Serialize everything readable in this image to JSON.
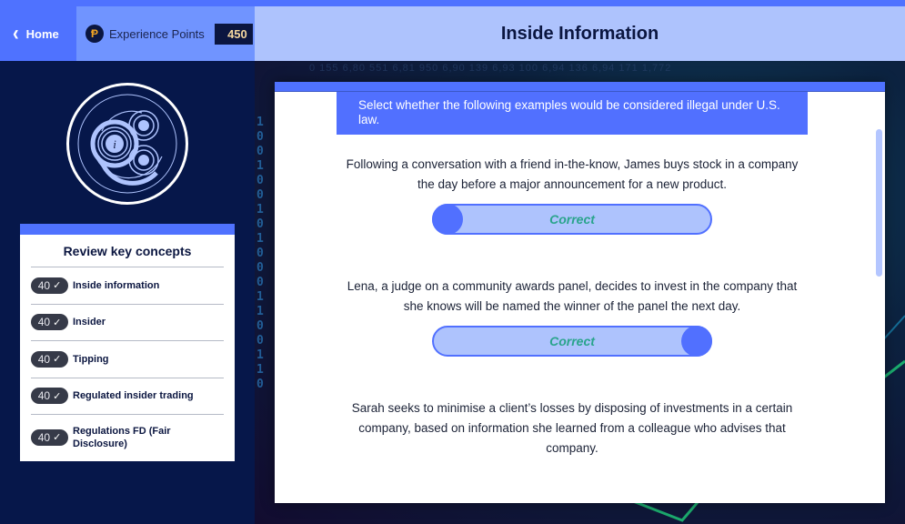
{
  "header": {
    "home_label": "Home",
    "home_icon": "chevron-left-icon",
    "xp_icon": "points-coin-icon",
    "xp_icon_glyph": "Ᵽ",
    "xp_label": "Experience Points",
    "xp_value": "450",
    "title": "Inside Information"
  },
  "sidebar": {
    "logo_icon": "inside-information-ripple-icon",
    "logo_glyph": "i",
    "review_title": "Review key concepts",
    "concepts": [
      {
        "points": "40",
        "check": "✓",
        "label": "Inside information"
      },
      {
        "points": "40",
        "check": "✓",
        "label": "Insider"
      },
      {
        "points": "40",
        "check": "✓",
        "label": "Tipping"
      },
      {
        "points": "40",
        "check": "✓",
        "label": "Regulated insider trading"
      },
      {
        "points": "40",
        "check": "✓",
        "label": "Regulations FD (Fair Disclosure)"
      }
    ]
  },
  "background": {
    "ticker": "0 155  6,80  551  6,81  950  6,90  139  6,93  100  6,94  136  6,94  171  1,772",
    "binary": "1001001010001100110"
  },
  "quiz": {
    "instruction": "Select whether the following examples would be considered illegal under U.S. law.",
    "questions": [
      {
        "text": "Following a conversation with a friend in-the-know, James buys stock in a company the day before a major announcement for a new product.",
        "toggle_position": "left",
        "result": "Correct"
      },
      {
        "text": "Lena, a judge on a community awards panel, decides to invest in the company that she knows will be named the winner of the panel the next day.",
        "toggle_position": "right",
        "result": "Correct"
      },
      {
        "text": "Sarah seeks to minimise a client’s losses by disposing of investments in a certain company, based on information she learned from a colleague who advises that company."
      }
    ]
  },
  "colors": {
    "brand_blue": "#4f72ff",
    "light_blue": "#aec3fd",
    "navy": "#06174a",
    "correct_green": "#2aa48c",
    "xp_gold": "#f5a623"
  }
}
